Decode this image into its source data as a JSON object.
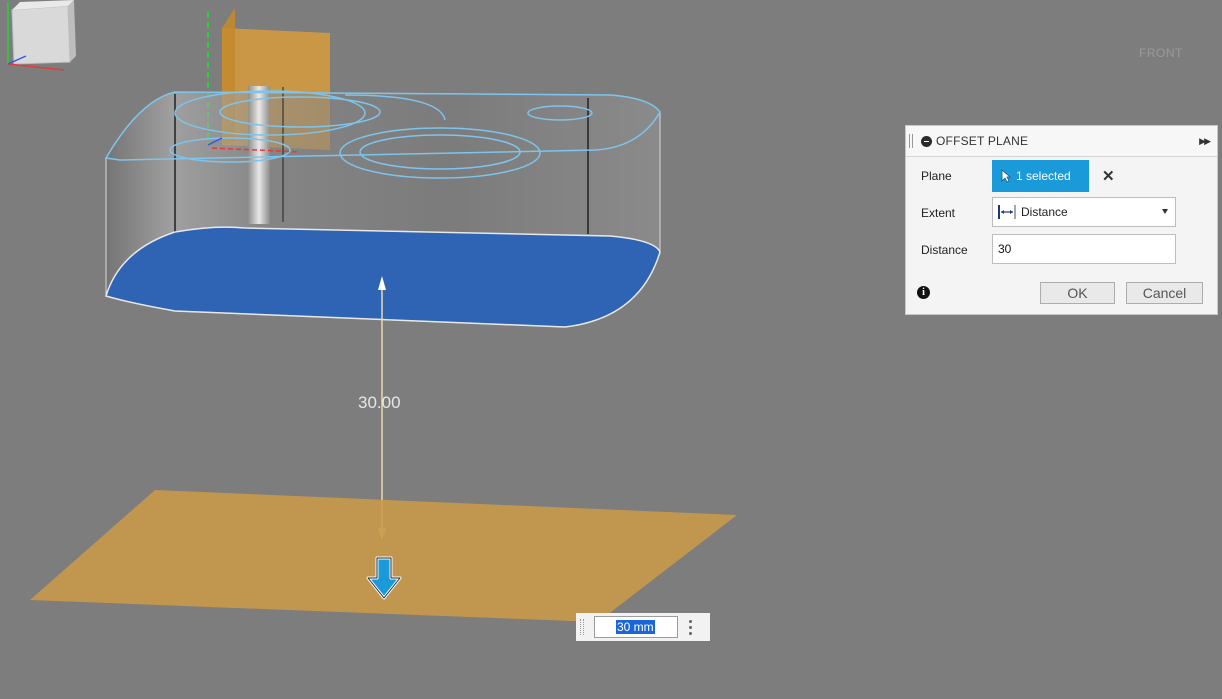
{
  "viewport": {
    "dimension_value": "30.00"
  },
  "viewcube": {
    "face_label": "FRONT"
  },
  "dialog": {
    "title": "OFFSET PLANE",
    "plane": {
      "label": "Plane",
      "selection": "1 selected"
    },
    "extent": {
      "label": "Extent",
      "value": "Distance"
    },
    "distance": {
      "label": "Distance",
      "value": "30"
    },
    "ok_label": "OK",
    "cancel_label": "Cancel"
  },
  "hud": {
    "value": "30 mm"
  },
  "colors": {
    "background": "#7d7d7d",
    "selected_face": "#2f63b4",
    "offset_plane": "#c99a4a",
    "accent": "#1a9ad9"
  }
}
